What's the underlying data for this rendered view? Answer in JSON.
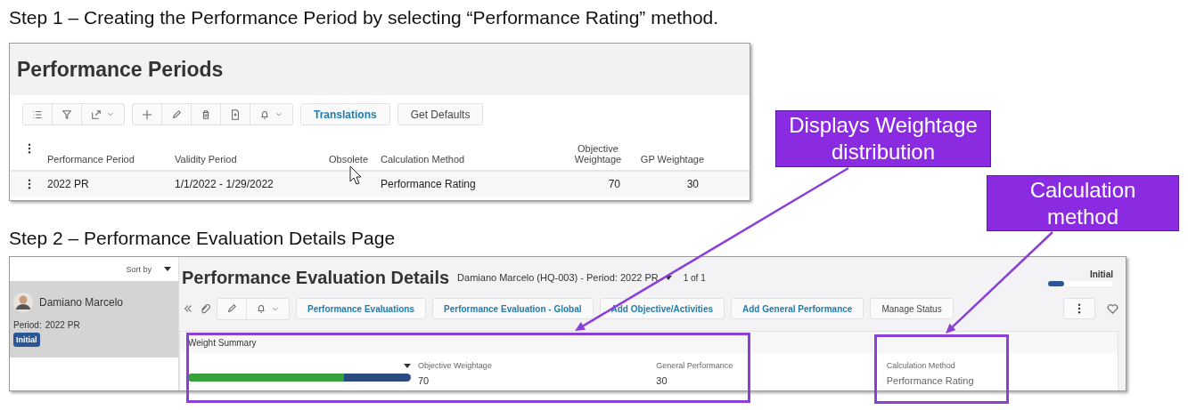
{
  "step1": {
    "caption": "Step 1 – Creating the Performance Period by selecting “Performance Rating” method."
  },
  "periods_screen": {
    "title": "Performance Periods",
    "toolbar_buttons": [
      {
        "label": "Translations",
        "kind": "link"
      },
      {
        "label": "Get Defaults",
        "kind": "plain"
      }
    ],
    "columns": [
      "Performance Period",
      "Validity Period",
      "Obsolete",
      "Calculation Method",
      "Objective Weightage",
      "GP Weightage"
    ],
    "rows": [
      {
        "period": "2022 PR",
        "validity": "1/1/2022 - 1/29/2022",
        "calculation_method": "Performance Rating",
        "objective_weightage": "70",
        "gp_weightage": "30"
      }
    ]
  },
  "step2": {
    "caption": "Step 2 – Performance Evaluation Details Page"
  },
  "details_screen": {
    "sidebar": {
      "sort_label": "Sort by",
      "employee": {
        "name": "Damiano Marcelo",
        "period_label": "Period:",
        "period": "2022 PR",
        "status": "Initial",
        "selected": true
      }
    },
    "title": "Performance Evaluation Details",
    "subtitle": "Damiano Marcelo (HQ-003) - Period: 2022 PR",
    "record_count": "1 of 1",
    "status": {
      "label": "Initial",
      "level": 0.25
    },
    "toolbar_buttons": [
      {
        "label": "Performance Evaluations",
        "kind": "link"
      },
      {
        "label": "Performance Evaluation - Global",
        "kind": "link"
      },
      {
        "label": "Add Objective/Activities",
        "kind": "link"
      },
      {
        "label": "Add General Performance",
        "kind": "link"
      },
      {
        "label": "Manage Status",
        "kind": "plain"
      }
    ],
    "weight_summary": {
      "title": "Weight Summary",
      "level": 0.7,
      "fields": [
        {
          "label": "Objective Weightage",
          "value": "70"
        },
        {
          "label": "General Performance",
          "value": "30"
        },
        {
          "label": "Calculation Method",
          "value": "Performance Rating"
        }
      ]
    }
  },
  "callouts": [
    {
      "text": "Displays Weightage distribution"
    },
    {
      "text": "Calculation method"
    }
  ]
}
